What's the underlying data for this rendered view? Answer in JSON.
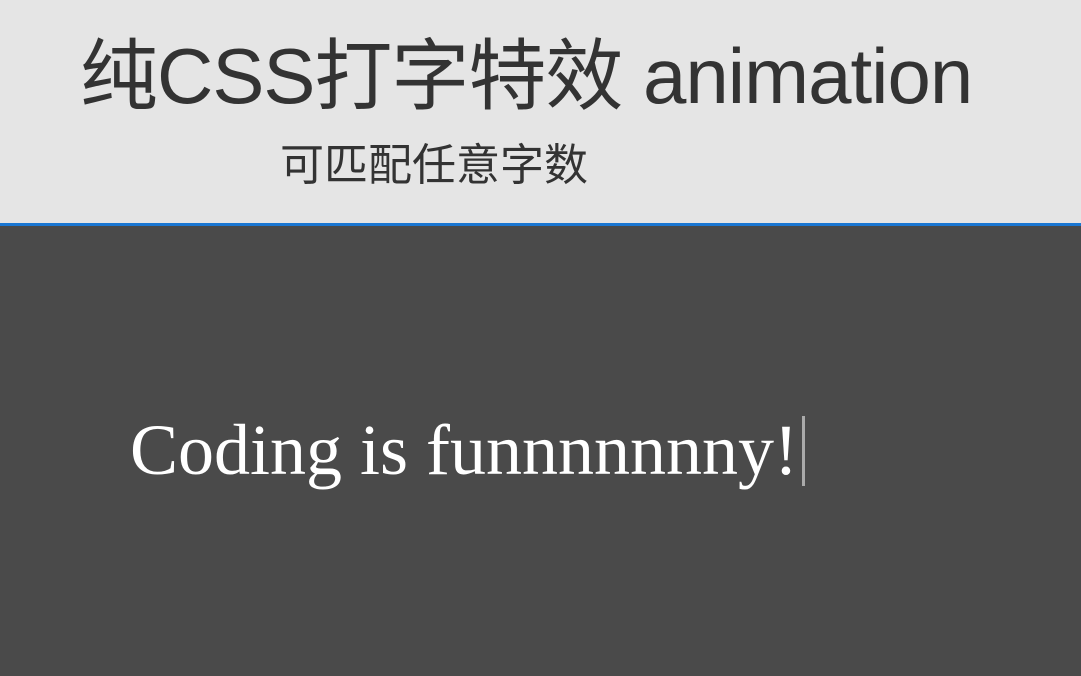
{
  "header": {
    "title": "纯CSS打字特效 animation",
    "subtitle": "可匹配任意字数"
  },
  "demo": {
    "typing_text": "Coding is funnnnnnny!"
  },
  "colors": {
    "divider": "#1976d2",
    "dark_bg": "#4a4a4a",
    "light_bg": "#e5e5e5",
    "text_dark": "#333333",
    "text_light": "#ffffff",
    "cursor": "#aaaaaa"
  }
}
